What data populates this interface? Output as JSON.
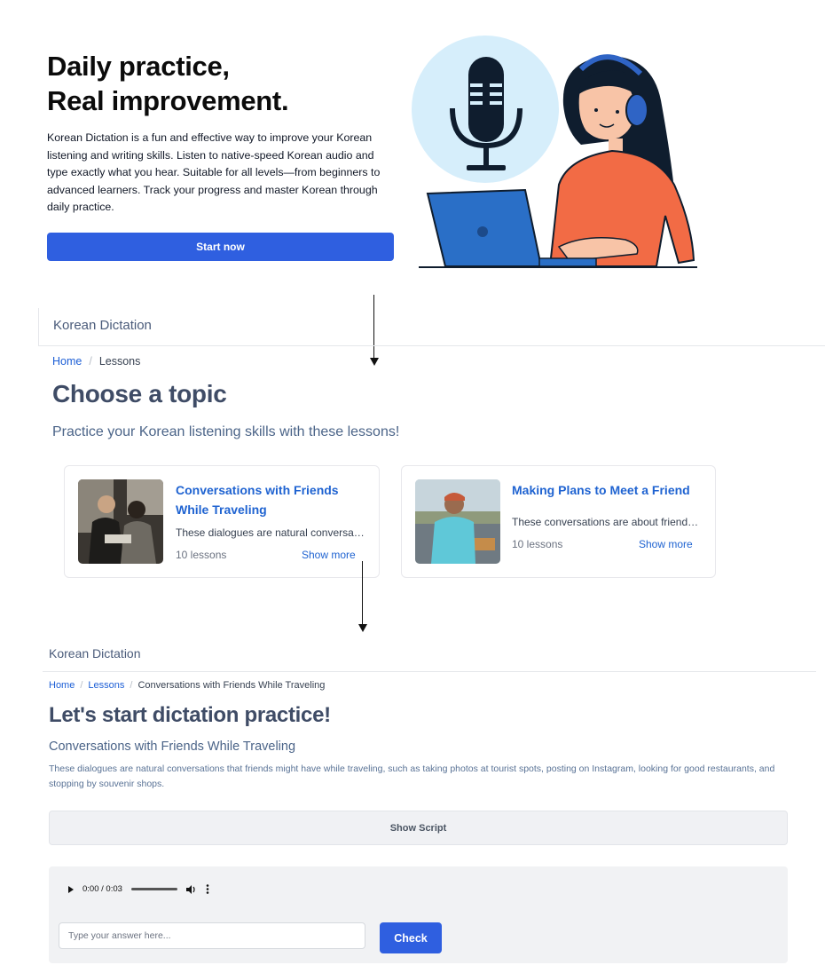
{
  "landing": {
    "title_line1": "Daily practice,",
    "title_line2": "Real improvement.",
    "description": "Korean Dictation is a fun and effective way to improve your Korean listening and writing skills. Listen to native-speed Korean audio and type exactly what you hear. Suitable for all levels—from beginners to advanced learners. Track your progress and master Korean through daily practice.",
    "start_button": "Start now",
    "illustration_icons": [
      "microphone-icon",
      "person-with-headphones",
      "laptop-icon"
    ]
  },
  "lessons_page": {
    "brand": "Korean Dictation",
    "breadcrumb": {
      "home": "Home",
      "current": "Lessons"
    },
    "heading": "Choose a topic",
    "subheading": "Practice your Korean listening skills with these lessons!",
    "cards": [
      {
        "title": "Conversations with Friends While Traveling",
        "description": "These dialogues are natural conversations that friends might have while traveling",
        "lessons": "10 lessons",
        "more": "Show more"
      },
      {
        "title": "Making Plans to Meet a Friend",
        "description": "These conversations are about friends making plans to meet",
        "lessons": "10 lessons",
        "more": "Show more"
      }
    ]
  },
  "dictation_page": {
    "brand": "Korean Dictation",
    "breadcrumb": {
      "home": "Home",
      "lessons": "Lessons",
      "current": "Conversations with Friends While Traveling"
    },
    "heading": "Let's start dictation practice!",
    "topic": "Conversations with Friends While Traveling",
    "description": "These dialogues are natural conversations that friends might have while traveling, such as taking photos at tourist spots, posting on Instagram, looking for good restaurants, and stopping by souvenir shops.",
    "show_script": "Show Script",
    "audio": {
      "time": "0:00 / 0:03",
      "progress": 0
    },
    "answer_placeholder": "Type your answer here...",
    "check_button": "Check"
  },
  "colors": {
    "primary": "#2f5fe0",
    "link": "#1f63d1",
    "heading": "#3f4c66",
    "muted_blue": "#4b6488"
  }
}
